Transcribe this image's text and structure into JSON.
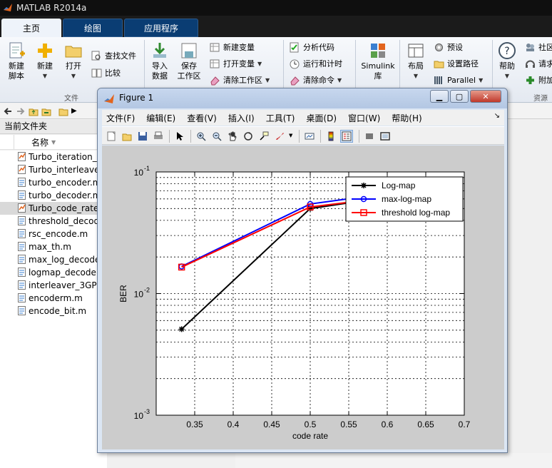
{
  "app": {
    "title": "MATLAB R2014a"
  },
  "tabs": [
    {
      "label": "主页",
      "active": true
    },
    {
      "label": "绘图",
      "active": false
    },
    {
      "label": "应用程序",
      "active": false
    }
  ],
  "ribbon": {
    "new_script": "新建\n脚本",
    "new": "新建",
    "open": "打开",
    "find_files": "查找文件",
    "compare": "比较",
    "group_file": "文件",
    "import_data": "导入\n数据",
    "save_workspace": "保存\n工作区",
    "new_variable": "新建变量",
    "open_variable": "打开变量",
    "clear_workspace": "清除工作区",
    "analyze_code": "分析代码",
    "run_and_time": "运行和计时",
    "clear_commands": "清除命令",
    "simulink": "Simulink\n库",
    "layout": "布局",
    "preferences": "预设",
    "set_path": "设置路径",
    "parallel": "Parallel",
    "help": "帮助",
    "community": "社区",
    "request_support": "请求",
    "addons": "附加",
    "group_resources": "资源"
  },
  "left_panel": {
    "title": "当前文件夹",
    "column_name": "名称",
    "files": [
      {
        "name": "Turbo_iteration_f",
        "type": "fig",
        "selected": false
      },
      {
        "name": "Turbo_interleave",
        "type": "fig",
        "selected": false
      },
      {
        "name": "turbo_encoder.m",
        "type": "m",
        "selected": false
      },
      {
        "name": "turbo_decoder.m",
        "type": "m",
        "selected": false
      },
      {
        "name": "Turbo_code_rate",
        "type": "fig",
        "selected": true
      },
      {
        "name": "threshold_decod",
        "type": "m",
        "selected": false
      },
      {
        "name": "rsc_encode.m",
        "type": "m",
        "selected": false
      },
      {
        "name": "max_th.m",
        "type": "m",
        "selected": false
      },
      {
        "name": "max_log_decode",
        "type": "m",
        "selected": false
      },
      {
        "name": "logmap_decode",
        "type": "m",
        "selected": false
      },
      {
        "name": "interleaver_3GPP",
        "type": "m",
        "selected": false
      },
      {
        "name": "encoderm.m",
        "type": "m",
        "selected": false
      },
      {
        "name": "encode_bit.m",
        "type": "m",
        "selected": false
      }
    ]
  },
  "figure": {
    "title": "Figure 1",
    "menus": [
      "文件(F)",
      "编辑(E)",
      "查看(V)",
      "插入(I)",
      "工具(T)",
      "桌面(D)",
      "窗口(W)",
      "帮助(H)"
    ],
    "toolbar_icons": [
      "new-figure-icon",
      "open-file-icon",
      "save-icon",
      "print-icon",
      "pointer-icon",
      "zoom-in-icon",
      "zoom-out-icon",
      "pan-icon",
      "rotate-icon",
      "data-cursor-icon",
      "brush-icon",
      "link-plot-icon",
      "colorbar-icon",
      "legend-icon",
      "hide-plot-tools-icon",
      "show-plot-tools-icon"
    ]
  },
  "chart_data": {
    "type": "line",
    "xlabel": "code rate",
    "ylabel": "BER",
    "xlim": [
      0.3,
      0.7
    ],
    "ylim": [
      0.001,
      0.1
    ],
    "yscale": "log",
    "xticks": [
      "0.35",
      "0.4",
      "0.45",
      "0.5",
      "0.55",
      "0.6",
      "0.65",
      "0.7"
    ],
    "yticks": [
      {
        "base": "10",
        "exp": "-3"
      },
      {
        "base": "10",
        "exp": "-2"
      },
      {
        "base": "10",
        "exp": "-1"
      }
    ],
    "grid": true,
    "legend_position": "top-right",
    "series": [
      {
        "name": "Log-map",
        "color": "#000000",
        "marker": "star",
        "x": [
          0.333,
          0.5,
          0.6
        ],
        "y": [
          0.0051,
          0.05,
          0.062
        ]
      },
      {
        "name": "max-log-map",
        "color": "#0000ff",
        "marker": "circle",
        "x": [
          0.333,
          0.5,
          0.6
        ],
        "y": [
          0.0167,
          0.0545,
          0.0665
        ]
      },
      {
        "name": "threshold log-map",
        "color": "#ff0000",
        "marker": "square",
        "x": [
          0.333,
          0.5,
          0.6
        ],
        "y": [
          0.0165,
          0.0515,
          0.0615
        ]
      }
    ]
  },
  "colors": {
    "matlab_blue": "#0a3d73",
    "ribbon_bg": "#eef3fa"
  }
}
